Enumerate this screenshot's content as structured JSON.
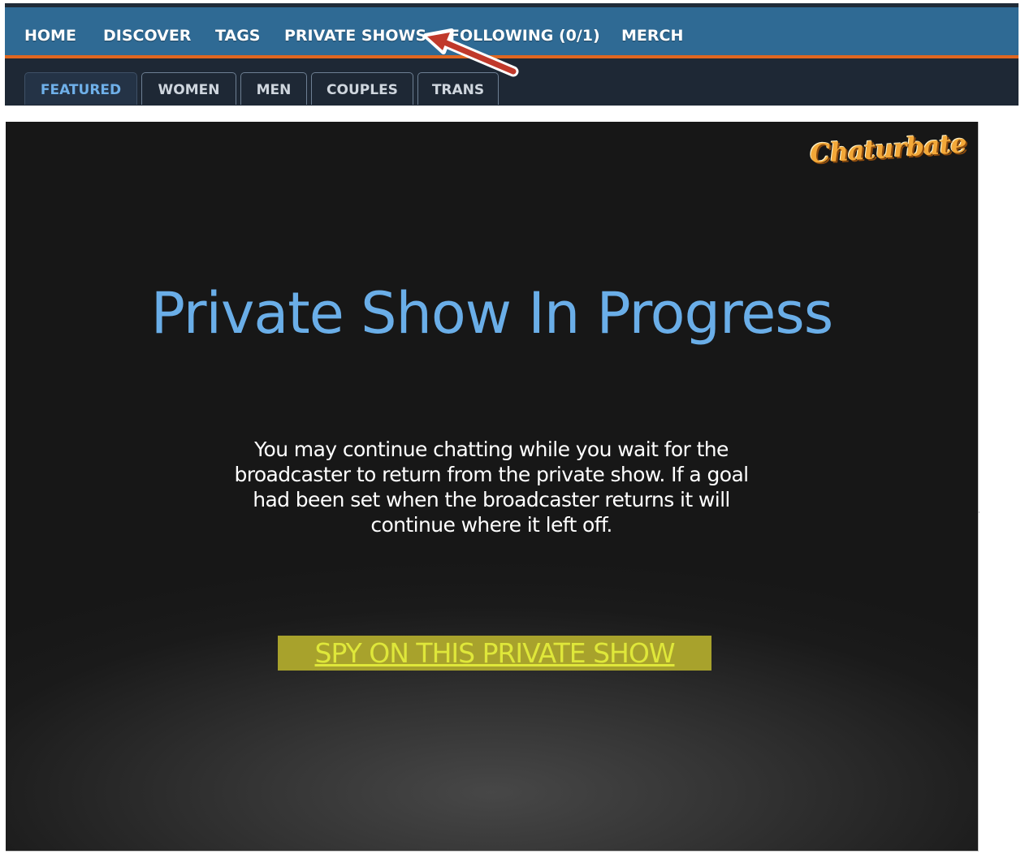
{
  "main_nav": {
    "items": [
      {
        "label": "HOME"
      },
      {
        "label": "DISCOVER"
      },
      {
        "label": "TAGS"
      },
      {
        "label": "PRIVATE SHOWS"
      },
      {
        "label": "FOLLOWING (0/1)"
      },
      {
        "label": "MERCH"
      }
    ]
  },
  "sub_tabs": {
    "items": [
      {
        "label": "FEATURED",
        "active": true
      },
      {
        "label": "WOMEN",
        "active": false
      },
      {
        "label": "MEN",
        "active": false
      },
      {
        "label": "COUPLES",
        "active": false
      },
      {
        "label": "TRANS",
        "active": false
      }
    ]
  },
  "player": {
    "logo_text": "Chaturbate",
    "title": "Private Show In Progress",
    "message": "You may continue chatting while you wait for the broadcaster to return from the private show. If a goal had been set when the broadcaster returns it will continue where it left off.",
    "spy_link_label": "SPY ON THIS PRIVATE SHOW"
  },
  "annotation": {
    "icon": "red-arrow-icon",
    "color": "#c0392b"
  },
  "colors": {
    "nav_bg": "#2f6a94",
    "nav_border": "#e0661f",
    "header_bg": "#1e2835",
    "title_color": "#6aaee8",
    "spy_highlight": "#a8a22c"
  }
}
